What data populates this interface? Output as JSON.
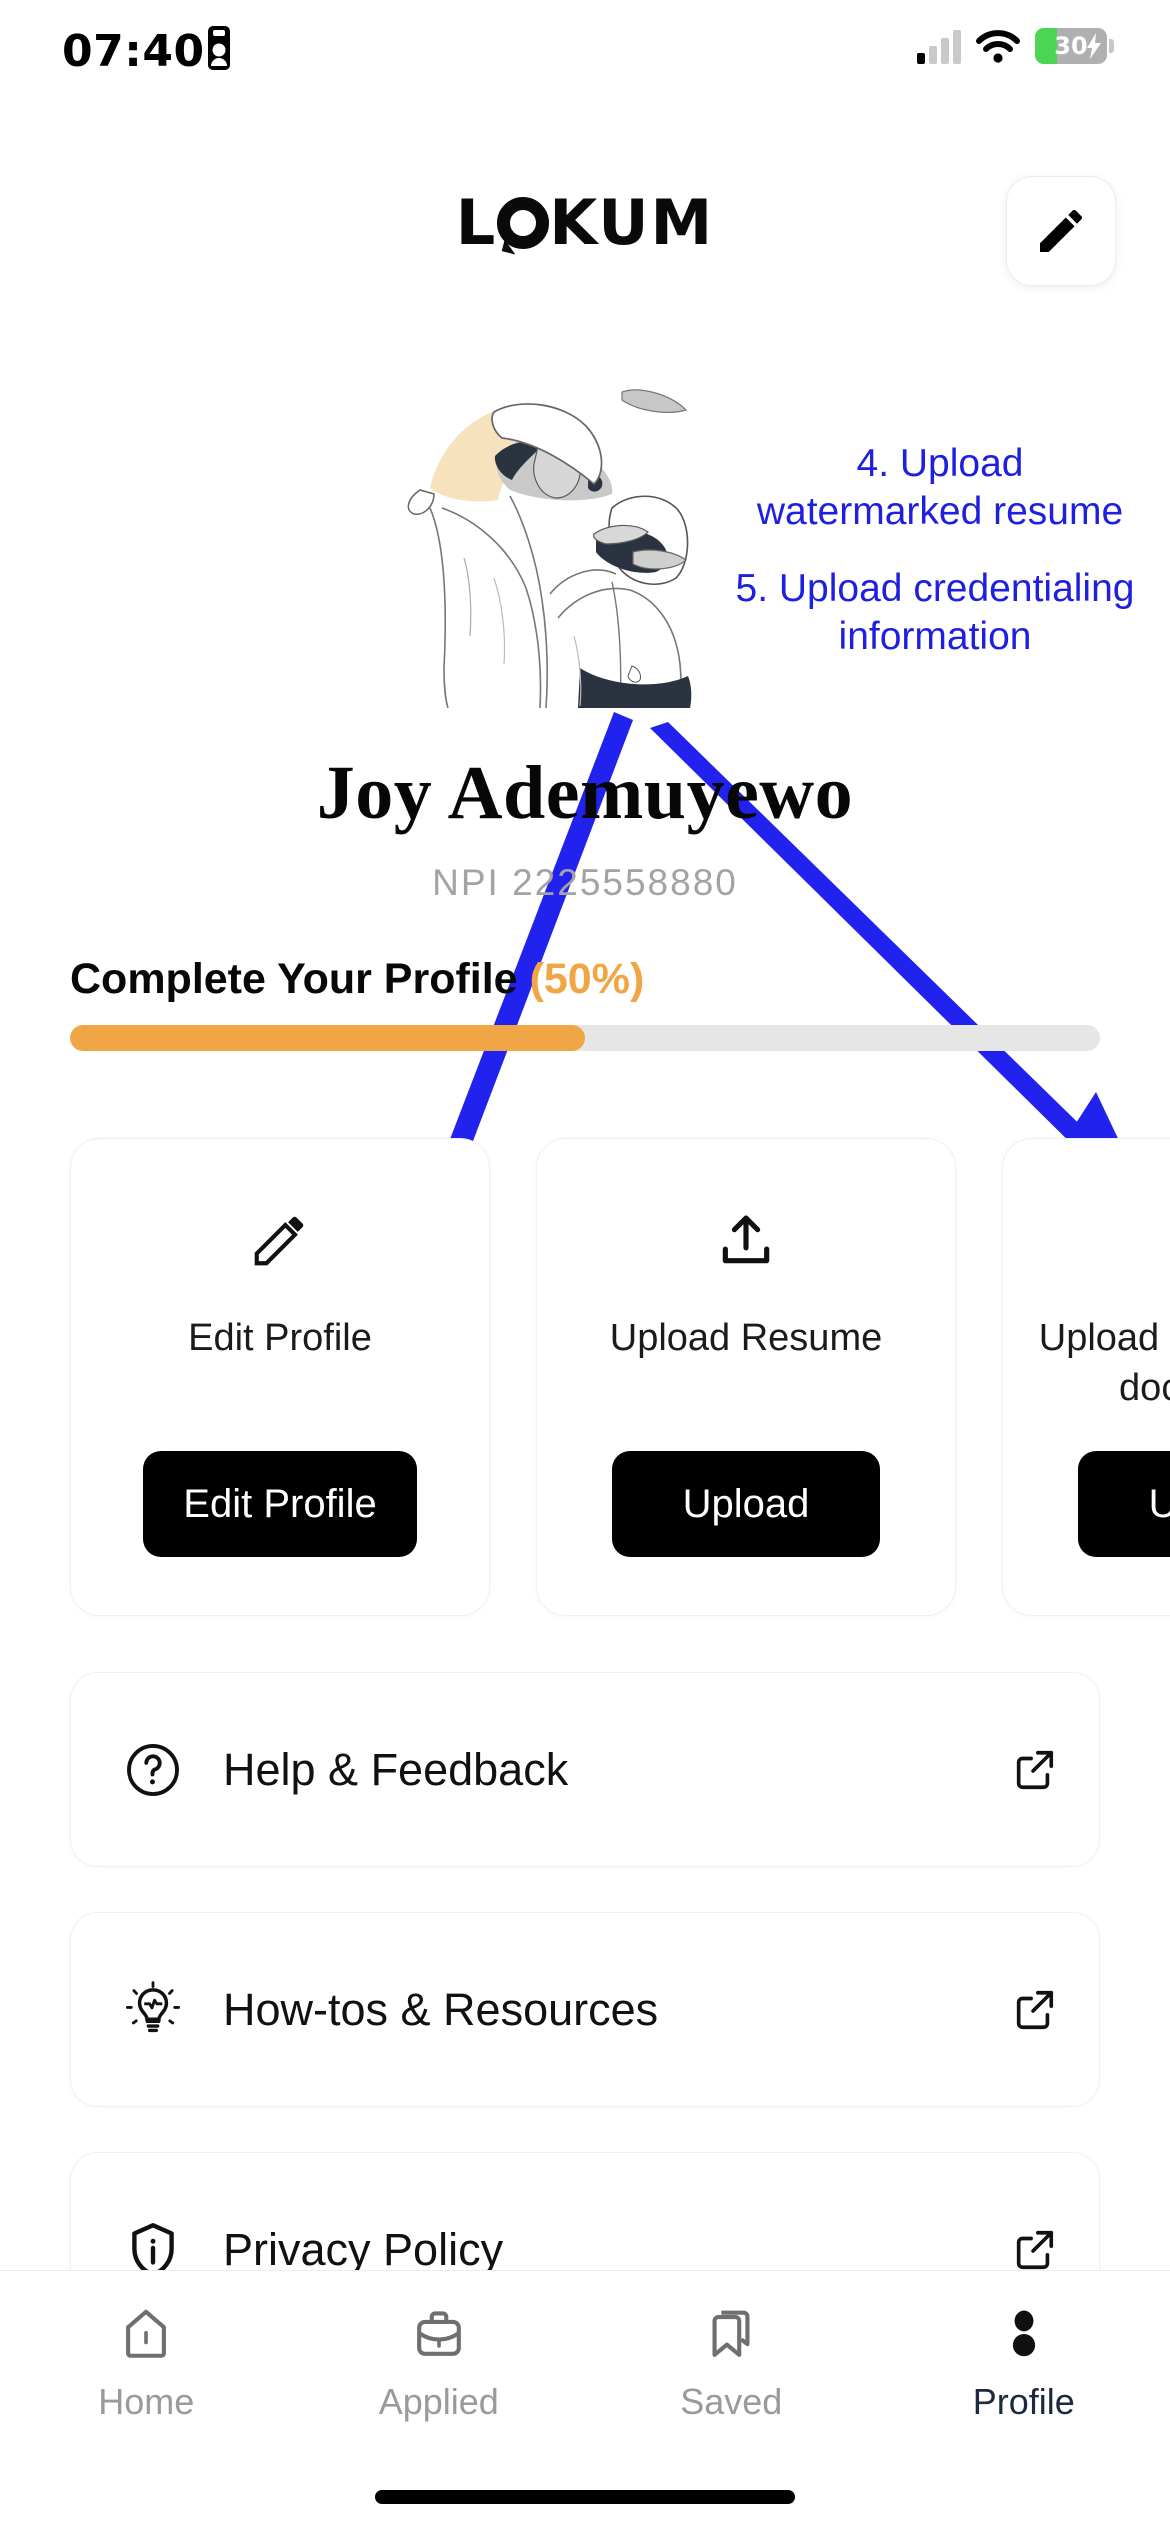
{
  "status_bar": {
    "time": "07:40",
    "recording_icon": "recording-indicator-icon",
    "signal_icon": "cellular-signal-icon",
    "wifi_icon": "wifi-icon",
    "battery_percent": "30",
    "battery_level": 30,
    "battery_charging_icon": "charging-bolt-icon"
  },
  "header": {
    "logo_before": "L",
    "logo_after": "KUM",
    "edit_button_icon": "pencil-icon"
  },
  "illustration": {
    "name": "medical-professionals-illustration",
    "accent_color": "#F7E2BE",
    "shade_color": "#C8C8C8",
    "line_color": "#4a4a4a"
  },
  "annotations": {
    "color": "#1f1fe0",
    "items": [
      {
        "id": "annot-4",
        "text": "4. Upload watermarked resume"
      },
      {
        "id": "annot-5",
        "text": "5. Upload credentialing information"
      }
    ],
    "arrow_color": "#2222EE"
  },
  "profile": {
    "name": "Joy Ademuyewo",
    "npi": "NPI 2225558880"
  },
  "progress": {
    "label": "Complete Your Profile",
    "percent_text": "(50%)",
    "percent_value": 50,
    "fill_color": "#F0A645",
    "track_color": "#e6e6e6"
  },
  "cards": [
    {
      "icon": "pencil-icon",
      "label": "Edit Profile",
      "button_label": "Edit Profile"
    },
    {
      "icon": "upload-icon",
      "label": "Upload Resume",
      "button_label": "Upload"
    },
    {
      "icon": "upload-icon",
      "label": "Upload credentialing documents",
      "button_label": "Upload"
    }
  ],
  "list_rows": [
    {
      "icon": "question-circle-icon",
      "label": "Help & Feedback",
      "action_icon": "external-link-icon"
    },
    {
      "icon": "lightbulb-icon",
      "label": "How-tos & Resources",
      "action_icon": "external-link-icon"
    },
    {
      "icon": "shield-info-icon",
      "label": "Privacy Policy",
      "action_icon": "external-link-icon"
    }
  ],
  "bottom_nav": {
    "active": "Profile",
    "items": [
      {
        "icon": "home-icon",
        "label": "Home",
        "active": false
      },
      {
        "icon": "briefcase-icon",
        "label": "Applied",
        "active": false
      },
      {
        "icon": "bookmark-icon",
        "label": "Saved",
        "active": false
      },
      {
        "icon": "person-icon",
        "label": "Profile",
        "active": true
      }
    ]
  }
}
